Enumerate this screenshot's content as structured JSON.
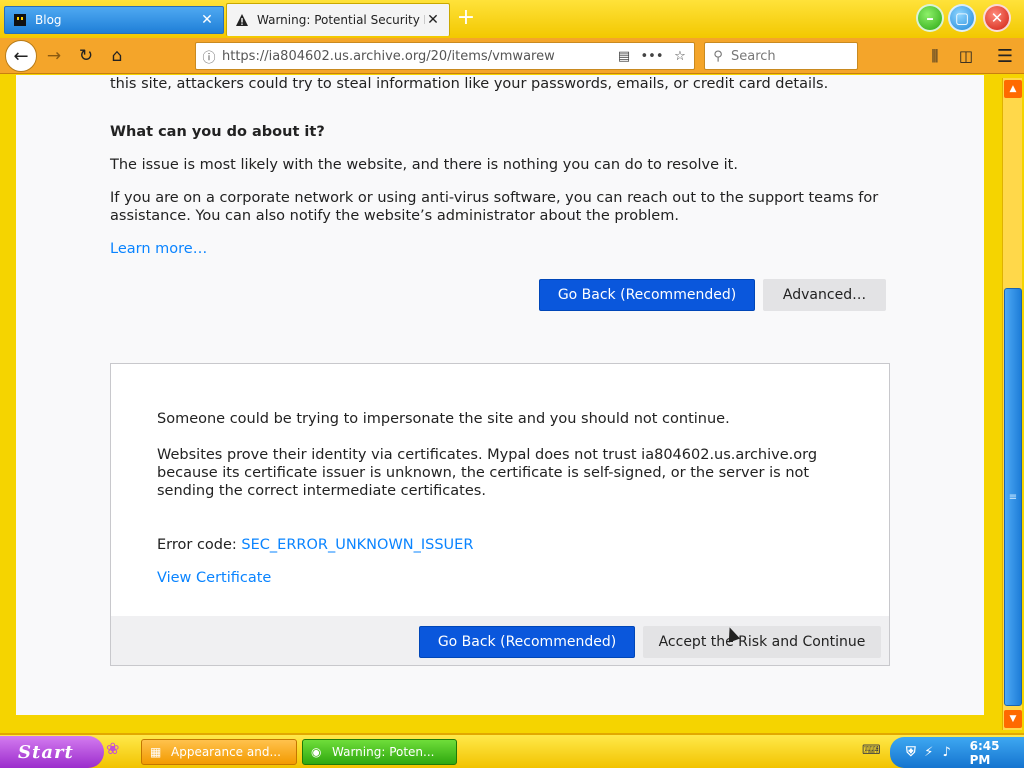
{
  "tabs": [
    {
      "label": "Blog",
      "favicon": "blog-favicon",
      "active": false
    },
    {
      "label": "Warning: Potential Security Risk Ahead",
      "favicon": "warning-icon",
      "active": true
    }
  ],
  "toolbar": {
    "url": "https://ia804602.us.archive.org/20/items/vmwarew",
    "search_placeholder": "Search"
  },
  "page": {
    "intro": "this site, attackers could try to steal information like your passwords, emails, or credit card details.",
    "what_heading": "What can you do about it?",
    "issue": "The issue is most likely with the website, and there is nothing you can do to resolve it.",
    "corporate": "If you are on a corporate network or using anti-virus software, you can reach out to the support teams for assistance. You can also notify the website’s administrator about the problem.",
    "learn_more": "Learn more…",
    "go_back": "Go Back (Recommended)",
    "advanced": "Advanced…"
  },
  "advanced_panel": {
    "impersonate": "Someone could be trying to impersonate the site and you should not continue.",
    "certificate": "Websites prove their identity via certificates. Mypal does not trust ia804602.us.archive.org because its certificate issuer is unknown, the certificate is self-signed, or the server is not sending the correct intermediate certificates.",
    "error_label": "Error code: ",
    "error_code": "SEC_ERROR_UNKNOWN_ISSUER",
    "view_certificate": "View Certificate",
    "go_back": "Go Back (Recommended)",
    "accept": "Accept the Risk and Continue"
  },
  "taskbar": {
    "start": "Start",
    "tasks": [
      {
        "label": "Appearance and..."
      },
      {
        "label": "Warning: Poten..."
      }
    ],
    "clock": "6:45 PM"
  },
  "colors": {
    "primary_button": "#0a57dc",
    "link": "#0a84ff",
    "theme_yellow": "#f5d400",
    "nav_orange": "#f4a52a"
  }
}
